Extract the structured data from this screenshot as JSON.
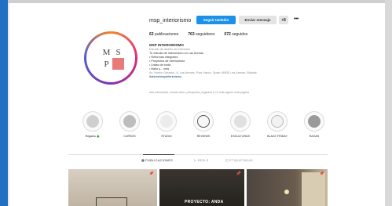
{
  "profile": {
    "username": "msp_interiorismo",
    "follow_label": "Seguir también",
    "message_label": "Enviar mensaje",
    "suggest_label": "+8",
    "more_label": "•••",
    "logo_letters": [
      "M",
      "S",
      "P",
      ""
    ],
    "stats": {
      "posts": "63",
      "posts_label": "publicaciones",
      "followers": "763",
      "followers_label": "seguidores",
      "following": "672",
      "following_label": "seguidos"
    },
    "bio_name": "MSP INTERIORISMO",
    "bio_lines": [
      "Estudio de diseño de interiores",
      "Tu estudio de interiorismo en Las Arenas",
      "• Reformas integrales",
      "• Proyectos de interiorismo",
      "• Listas de boda",
      "• Baño y... más",
      "Av. Nuevo Getxeko, 8, Las Arenas, País Vasco, Spain 48930 Las Arenas, Bizkaia"
    ],
    "bio_link": "linktr.ee/mspinteriorismo",
    "followed_by": "arte.interiorista, mundo.deco, peluqueria_organica y 10 más siguen esta página"
  },
  "highlights": [
    {
      "label": "Regalos 🎄",
      "color": "#cfcfcf"
    },
    {
      "label": "CURSOS",
      "color": "#bdbdbd"
    },
    {
      "label": "STUDIO",
      "color": "#ececec"
    },
    {
      "label": "REVIEWS",
      "color": "#f7f7f7"
    },
    {
      "label": "ESCULTURAS",
      "color": "#e0e0e0"
    },
    {
      "label": "BLACK FRIDAY",
      "color": "#f2f2f2"
    },
    {
      "label": "RAGAS",
      "color": "#9a9a9a"
    }
  ],
  "tabs": [
    {
      "label": "PUBLICACIONES"
    },
    {
      "label": "REELS"
    },
    {
      "label": "ETIQUETADAS"
    }
  ],
  "posts": [
    {
      "caption": ""
    },
    {
      "caption": "PROYECTO: ANDA"
    },
    {
      "caption": ""
    }
  ],
  "colors": {
    "follow_button": "#1c91e8",
    "page_background": "#ffffff"
  }
}
